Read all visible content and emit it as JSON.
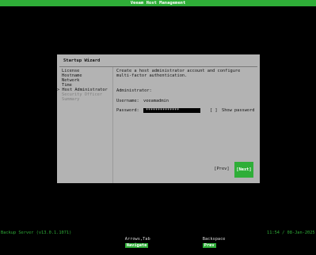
{
  "app_title": "Veeam Host Management",
  "dialog": {
    "title": "Startup Wizard",
    "nav": [
      {
        "label": "License",
        "state": "done"
      },
      {
        "label": "Hostname",
        "state": "done"
      },
      {
        "label": "Network",
        "state": "done"
      },
      {
        "label": "Time",
        "state": "done"
      },
      {
        "label": "Host Administrator",
        "state": "current"
      },
      {
        "label": "Security Officer",
        "state": "pending"
      },
      {
        "label": "Summary",
        "state": "pending"
      }
    ],
    "current_marker": ">",
    "description_line1": "Create a host administrator account and configure",
    "description_line2": "multi-factor authentication.",
    "section_label": "Administrator:",
    "username_label": "Username:",
    "username_value": "veeamadmin",
    "password_label": "Password:",
    "password_value": "**************",
    "show_password_checkbox": "[ ]",
    "show_password_label": "Show password",
    "prev_button": "[Prev]",
    "next_button": "[Next]"
  },
  "statusbar": {
    "server": "Backup Server (v13.0.1.1071)",
    "arrows_key": "Arrows,Tab",
    "arrows_action": "Navigate",
    "backspace_key": "Backspace",
    "backspace_action": "Prev",
    "clock": "11:54 / 08-Jan-2025"
  },
  "colors": {
    "accent": "#2fae38",
    "dialog_bg": "#b3b3b3",
    "screen_bg": "#000000"
  }
}
